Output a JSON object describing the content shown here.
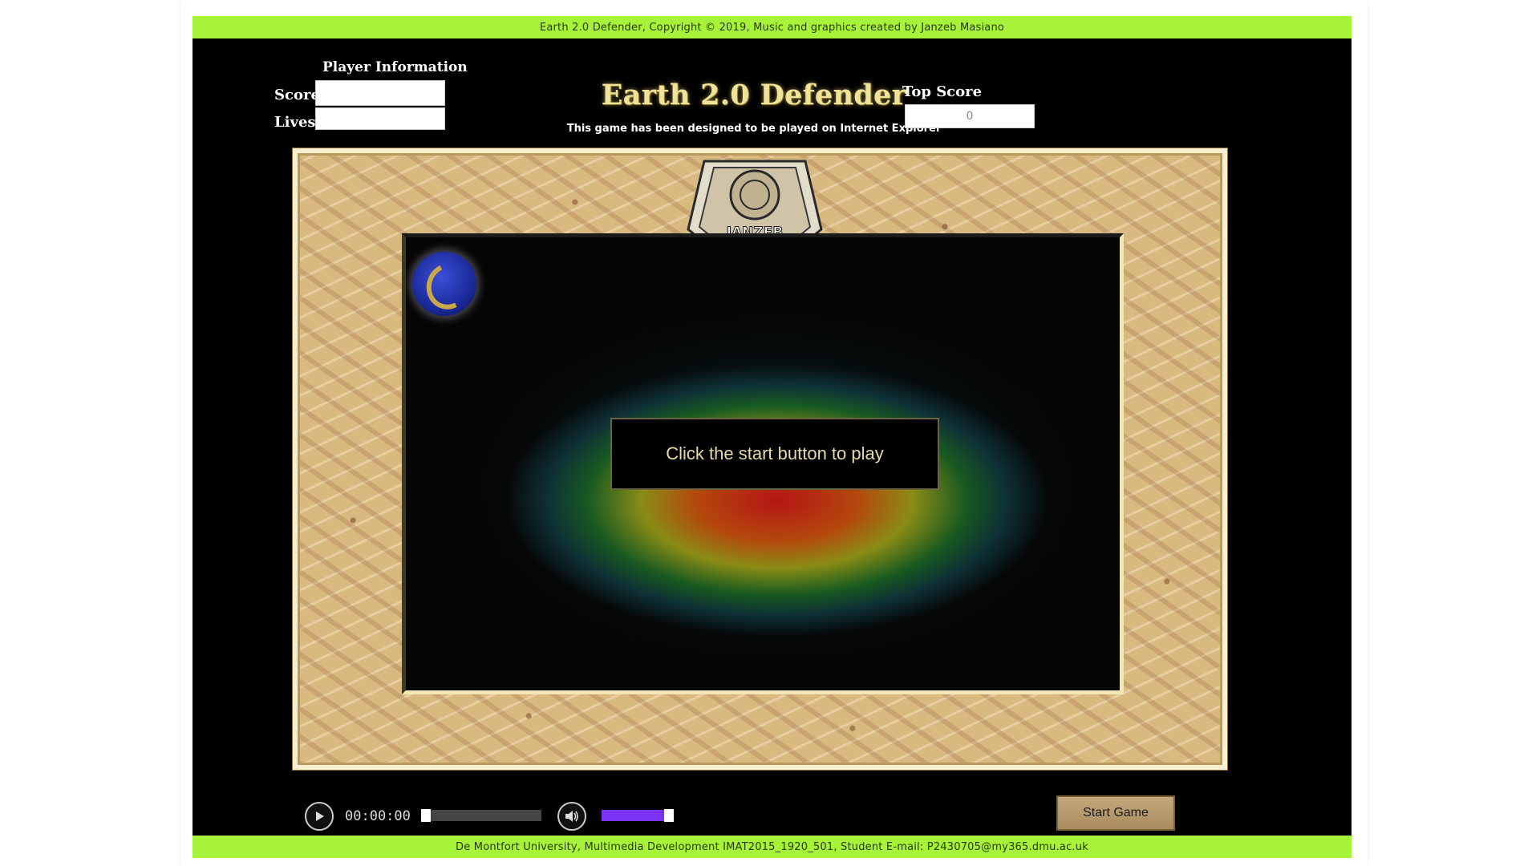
{
  "header": {
    "copyright": "Earth 2.0 Defender, Copyright © 2019, Music and graphics created by Janzeb Masiano",
    "footer": "De Montfort University, Multimedia Development IMAT2015_1920_501, Student E-mail: P2430705@my365.dmu.ac.uk"
  },
  "player": {
    "heading": "Player Information",
    "score_label": "Score",
    "score_value": "",
    "lives_label": "Lives",
    "lives_value": ""
  },
  "game": {
    "title": "Earth 2.0 Defender",
    "subtitle": "This game has been designed to be played on Internet Explorer",
    "start_message": "Click the start button to play",
    "emblem_text": "JANZEB"
  },
  "top_score": {
    "label": "Top Score",
    "value": "0"
  },
  "controls": {
    "time": "00:00:00",
    "seek_fraction": 0.0,
    "volume_fraction": 1.0,
    "start_button": "Start Game"
  },
  "colors": {
    "banner": "#a6f33a",
    "title": "#f1e29a",
    "volume": "#7a33f2",
    "frame": "#d8b980"
  },
  "icons": [
    "play-icon",
    "volume-icon",
    "planet-icon"
  ]
}
